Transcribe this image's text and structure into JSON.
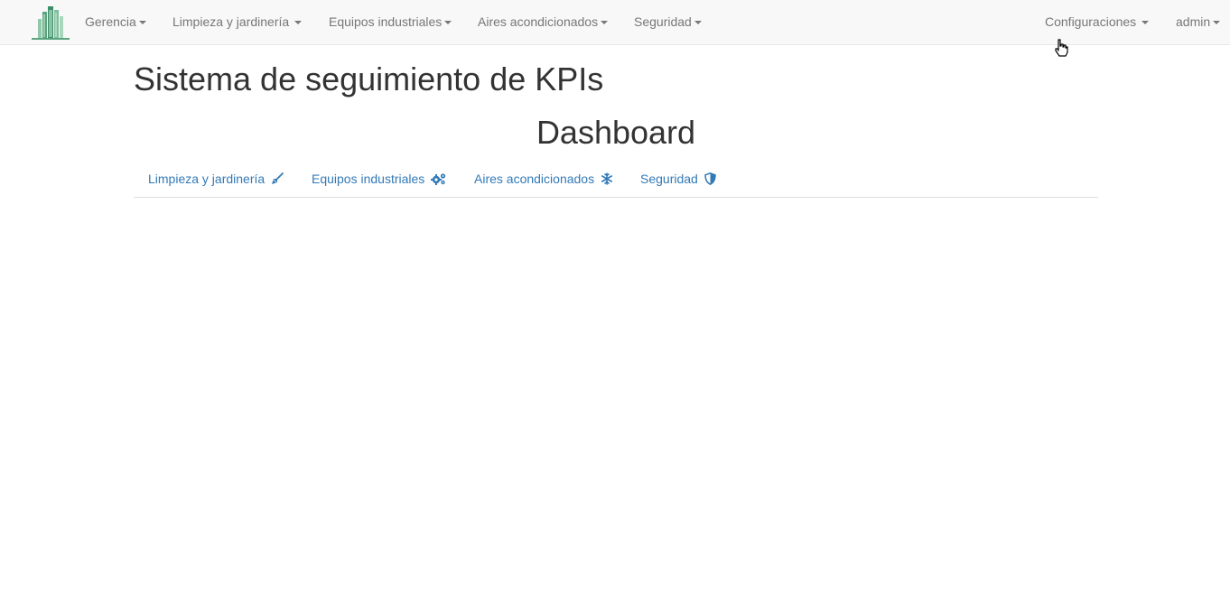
{
  "navbar": {
    "brand_icon": "buildings-logo-icon",
    "left_items": [
      {
        "label": "Gerencia"
      },
      {
        "label": "Limpieza y jardinería"
      },
      {
        "label": "Equipos industriales"
      },
      {
        "label": "Aires acondicionados"
      },
      {
        "label": "Seguridad"
      }
    ],
    "right_items": [
      {
        "label": "Configuraciones"
      },
      {
        "label": "admin"
      }
    ]
  },
  "page": {
    "title": "Sistema de seguimiento de KPIs",
    "subtitle": "Dashboard"
  },
  "tabs": [
    {
      "label": "Limpieza y jardinería",
      "icon": "broom-icon"
    },
    {
      "label": "Equipos industriales",
      "icon": "gears-icon"
    },
    {
      "label": "Aires acondicionados",
      "icon": "snowflake-icon"
    },
    {
      "label": "Seguridad",
      "icon": "shield-icon"
    }
  ],
  "colors": {
    "navbar_bg": "#f8f8f8",
    "nav_text": "#777777",
    "link": "#337ab7",
    "heading": "#333333"
  }
}
